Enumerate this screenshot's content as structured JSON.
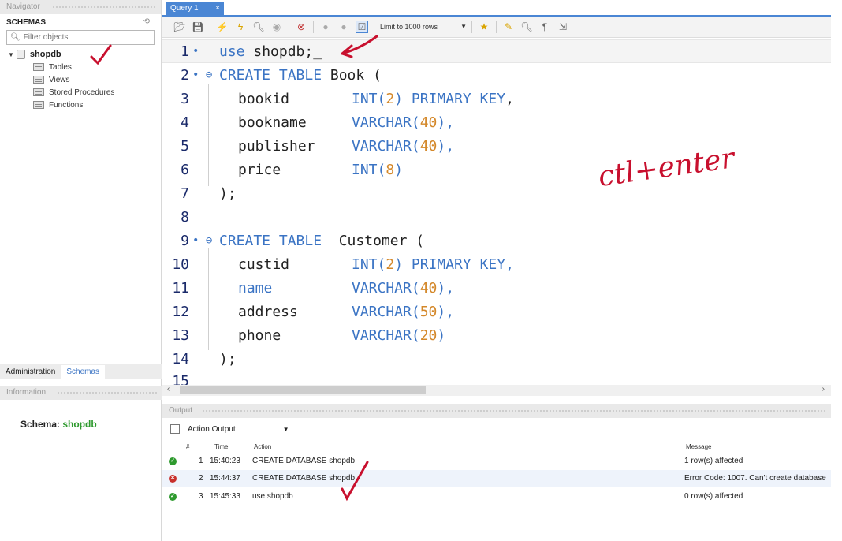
{
  "navigator": {
    "title": "Navigator",
    "schemas_label": "SCHEMAS",
    "filter_placeholder": "Filter objects",
    "database": "shopdb",
    "children": [
      "Tables",
      "Views",
      "Stored Procedures",
      "Functions"
    ]
  },
  "bottom_tabs": {
    "admin": "Administration",
    "schemas": "Schemas"
  },
  "information": {
    "title": "Information",
    "schema_label": "Schema:",
    "schema_value": "shopdb"
  },
  "query_tab": {
    "label": "Query 1",
    "close": "×"
  },
  "toolbar": {
    "limit_label": "Limit to 1000 rows"
  },
  "editor": {
    "l1": {
      "n": "1",
      "m": "•",
      "a": "use",
      "b": " shopdb;_"
    },
    "l2": {
      "n": "2",
      "m": "• ⊖",
      "a": "CREATE TABLE",
      "b": " Book ("
    },
    "l3": {
      "n": "3",
      "col": "bookid",
      "t": "INT(",
      "v": "2",
      ")": ")",
      "extra": " PRIMARY KEY",
      ",": ","
    },
    "l4": {
      "n": "4",
      "col": "bookname",
      "t": "VARCHAR(",
      "v": "40",
      "e": "),"
    },
    "l5": {
      "n": "5",
      "col": "publisher",
      "t": "VARCHAR(",
      "v": "40",
      "e": "),"
    },
    "l6": {
      "n": "6",
      "col": "price",
      "t": "INT(",
      "v": "8",
      "e": ")"
    },
    "l7": {
      "n": "7",
      "b": ");"
    },
    "l8": {
      "n": "8"
    },
    "l9": {
      "n": "9",
      "m": "• ⊖",
      "a": "CREATE TABLE",
      "b": "  Customer ("
    },
    "l10": {
      "n": "10",
      "col": "custid",
      "t": "INT(",
      "v": "2",
      "extra": ") PRIMARY KEY,"
    },
    "l11": {
      "n": "11",
      "col": "name",
      "t": "VARCHAR(",
      "v": "40",
      "e": "),"
    },
    "l12": {
      "n": "12",
      "col": "address",
      "t": "VARCHAR(",
      "v": "50",
      "e": "),"
    },
    "l13": {
      "n": "13",
      "col": "phone",
      "t": "VARCHAR(",
      "v": "20",
      "e": ")"
    },
    "l14": {
      "n": "14",
      "b": ");"
    },
    "l15": {
      "n": "15"
    }
  },
  "annotation_text": "ctl+enter",
  "output": {
    "title": "Output",
    "selector": "Action Output",
    "headers": {
      "num": "#",
      "time": "Time",
      "action": "Action",
      "message": "Message"
    },
    "rows": [
      {
        "num": "1",
        "time": "15:40:23",
        "action": "CREATE DATABASE shopdb",
        "message": "1 row(s) affected",
        "status": "ok"
      },
      {
        "num": "2",
        "time": "15:44:37",
        "action": "CREATE DATABASE shopdb",
        "message": "Error Code: 1007. Can't create database",
        "status": "error"
      },
      {
        "num": "3",
        "time": "15:45:33",
        "action": "use shopdb",
        "message": "0 row(s) affected",
        "status": "ok"
      }
    ]
  },
  "colors": {
    "keyword": "#3b74c4",
    "number": "#d4882a",
    "annotation": "#c8102e",
    "ok": "#2e9a2e",
    "error": "#c8302c"
  }
}
